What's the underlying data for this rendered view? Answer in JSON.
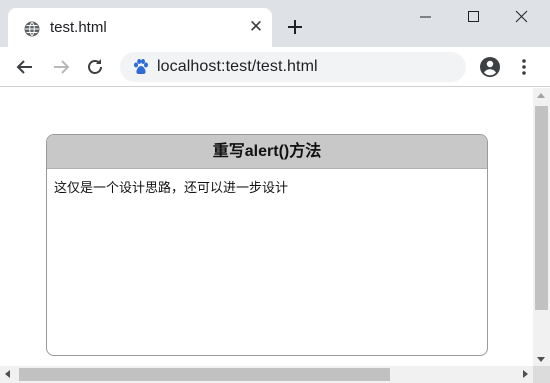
{
  "browser": {
    "tab": {
      "title": "test.html",
      "favicon": "globe-icon",
      "close_glyph": "✕"
    },
    "new_tab_icon": "plus-icon",
    "window_controls": [
      "minimize-icon",
      "maximize-icon",
      "close-icon"
    ],
    "toolbar": {
      "back_icon": "back-arrow-icon",
      "forward_icon": "forward-arrow-icon",
      "reload_icon": "reload-icon",
      "site_icon": "baidu-paw-icon",
      "url": "localhost:test/test.html",
      "profile_icon": "account-icon",
      "menu_icon": "more-vert-icon"
    }
  },
  "page": {
    "dialog": {
      "title": "重写alert()方法",
      "message": "这仅是一个设计思路，还可以进一步设计"
    }
  },
  "colors": {
    "tabstrip_bg": "#dee1e6",
    "omnibox_bg": "#f1f3f4",
    "dialog_header_bg": "#c8c8c8",
    "site_icon_blue": "#2f6bd8"
  }
}
